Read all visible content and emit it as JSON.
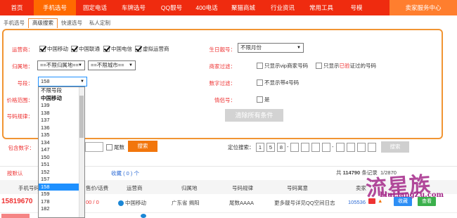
{
  "nav": {
    "items": [
      "首页",
      "手机选号",
      "固定电话",
      "车牌选号",
      "QQ靓号",
      "400电话",
      "聚猫商城",
      "行业资讯",
      "常用工具",
      "号模"
    ],
    "seller": "卖家服务中心"
  },
  "subtabs": [
    "手机选号",
    "高级搜索",
    "快速选号",
    "私人定制"
  ],
  "filters": {
    "carrier_label": "运营商：",
    "carriers": [
      "中国移动",
      "中国联通",
      "中国电信",
      "虚拟运营商"
    ],
    "location_label": "归属地：",
    "province": "==不限归属地==",
    "city": "==不限城市==",
    "segment_label": "号段：",
    "segment_value": "158",
    "price_label": "价格范围：",
    "pattern_label": "号码规律：",
    "contains_label": "包含数字：",
    "tail_label": "尾数",
    "search_btn": "搜索",
    "birthday_label": "生日靓号：",
    "birthday_value": "不限月份",
    "merchant_label": "商家过滤：",
    "vip_only": "只显示vip商家号码",
    "verified_prefix": "只显示",
    "verified_red": "已验",
    "verified_suffix": "证过的号码",
    "digit_label": "数字过滤：",
    "no_four": "不显示带4号码",
    "lovers_label": "情侣号：",
    "lovers_yes": "是",
    "clear_btn": "清除所有条件"
  },
  "dropdown": {
    "items": [
      "不限号段",
      "中国移动",
      "139",
      "138",
      "137",
      "136",
      "135",
      "134",
      "147",
      "150",
      "151",
      "152",
      "157",
      "158",
      "159",
      "178",
      "182"
    ],
    "bold": [
      "中国移动"
    ],
    "selected": "158"
  },
  "locate": {
    "label": "定位搜索：",
    "digits": [
      "1",
      "5",
      "8",
      "",
      "",
      "",
      "",
      "",
      "",
      "",
      ""
    ],
    "btn": "搜索"
  },
  "results": {
    "default_tab": "按默认",
    "fav_label": "收藏",
    "fav_count": "( 0 ) 个",
    "total_prefix": "共",
    "total": "114790",
    "total_suffix": "条记录",
    "page": "1/2870"
  },
  "table": {
    "headers": [
      "手机号码",
      "售价/话费",
      "运营商",
      "归属地",
      "号码规律",
      "号码寓意",
      "卖家"
    ],
    "row": {
      "number": "15819670",
      "price": "00 / 0",
      "carrier": "中国移动",
      "location": "广东省 揭阳",
      "pattern": "尾数AAAA",
      "meaning": "更多靓号详见QQ空间日志",
      "seller": "105536",
      "btn_fav": "收藏",
      "btn_view": "查看"
    }
  },
  "watermark": {
    "text": "流星族",
    "url": "LiuLiangZu.com"
  },
  "colors": {
    "nav_red": "#ef2b0f",
    "nav_active": "#ff6a00",
    "panel_border": "#f19533",
    "label_red": "#e33333",
    "orange_btn": "#f2760c",
    "select_blue": "#1e90ff"
  }
}
